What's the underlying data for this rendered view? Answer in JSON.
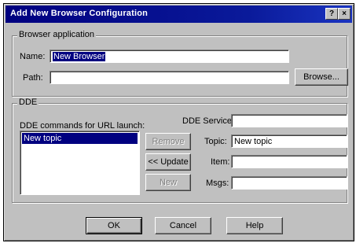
{
  "window": {
    "title": "Add New Browser Configuration",
    "help_glyph": "?",
    "close_glyph": "×"
  },
  "browser_group": {
    "legend": "Browser application",
    "name_label": "Name:",
    "name_value": "New Browser",
    "path_label": "Path:",
    "path_value": "",
    "browse_button": "Browse..."
  },
  "dde_group": {
    "legend": "DDE",
    "commands_label": "DDE commands for URL launch:",
    "commands": [
      "New topic"
    ],
    "remove_button": "Remove",
    "update_button": "<< Update",
    "new_button": "New",
    "service_label": "DDE Service:",
    "service_value": "",
    "topic_label": "Topic:",
    "topic_value": "New topic",
    "item_label": "Item:",
    "item_value": "",
    "msgs_label": "Msgs:",
    "msgs_value": ""
  },
  "footer": {
    "ok_button": "OK",
    "cancel_button": "Cancel",
    "help_button": "Help"
  }
}
